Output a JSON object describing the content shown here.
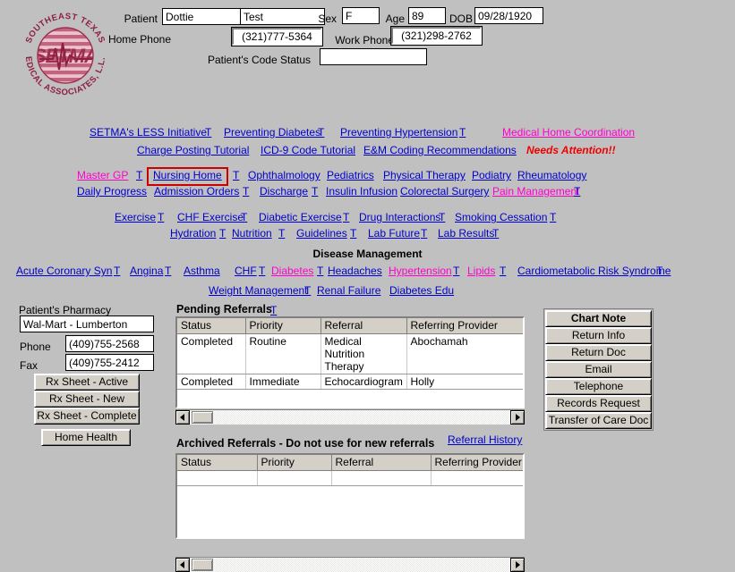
{
  "logo": {
    "top_arc": "SOUTHEAST TEXAS",
    "bottom_arc": "MEDICAL ASSOCIATES, L.L.P.",
    "center": "SETMA",
    "colors": {
      "dark": "#9e2f50",
      "mid": "#c4637f",
      "light": "#dba0b0"
    }
  },
  "patient": {
    "label_patient": "Patient",
    "first_name": "Dottie",
    "last_name": "Test",
    "label_sex": "Sex",
    "sex": "F",
    "label_age": "Age",
    "age": "89",
    "label_dob": "DOB",
    "dob": "09/28/1920",
    "label_home_phone": "Home Phone",
    "home_phone": "(321)777-5364",
    "label_work_phone": "Work Phone",
    "work_phone": "(321)298-2762",
    "label_code_status": "Patient's Code Status",
    "code_status": ""
  },
  "nav": {
    "t_label": "T",
    "row1": [
      {
        "label": "SETMA's LESS Initiative",
        "color": "blue",
        "t": true
      },
      {
        "label": "Preventing Diabetes",
        "color": "blue",
        "t": true
      },
      {
        "label": "Preventing Hypertension",
        "color": "blue",
        "t": true
      }
    ],
    "row1_right": {
      "label": "Medical Home Coordination",
      "color": "magenta",
      "alert": "Needs Attention!!"
    },
    "row2": [
      {
        "label": "Charge Posting Tutorial",
        "color": "blue",
        "t": false
      },
      {
        "label": "ICD-9 Code Tutorial",
        "color": "blue",
        "t": false
      },
      {
        "label": "E&M Coding Recommendations",
        "color": "blue",
        "t": false
      }
    ],
    "row3": [
      {
        "label": "Master GP",
        "color": "magenta",
        "t": true
      },
      {
        "label": "Nursing Home",
        "color": "blue",
        "t": true,
        "highlighted": true
      },
      {
        "label": "Ophthalmology",
        "color": "blue",
        "t": false
      },
      {
        "label": "Pediatrics",
        "color": "blue",
        "t": false
      },
      {
        "label": "Physical Therapy",
        "color": "blue",
        "t": false
      },
      {
        "label": "Podiatry",
        "color": "blue",
        "t": false
      },
      {
        "label": "Rheumatology",
        "color": "blue",
        "t": false
      }
    ],
    "row4": [
      {
        "label": "Daily Progress",
        "color": "blue",
        "t": false
      },
      {
        "label": "Admission Orders",
        "color": "blue",
        "t": true
      },
      {
        "label": "Discharge",
        "color": "blue",
        "t": true
      },
      {
        "label": "Insulin Infusion",
        "color": "blue",
        "t": false
      },
      {
        "label": "Colorectal Surgery",
        "color": "blue",
        "t": false
      },
      {
        "label": "Pain Management",
        "color": "magenta",
        "t": true
      }
    ],
    "row5": [
      {
        "label": "Exercise",
        "color": "blue",
        "t": true
      },
      {
        "label": "CHF Exercise",
        "color": "blue",
        "t": true
      },
      {
        "label": "Diabetic Exercise",
        "color": "blue",
        "t": true
      },
      {
        "label": "Drug Interactions",
        "color": "blue",
        "t": true
      },
      {
        "label": "Smoking Cessation",
        "color": "blue",
        "t": true
      }
    ],
    "row6": [
      {
        "label": "Hydration",
        "color": "blue",
        "t": true
      },
      {
        "label": "Nutrition",
        "color": "blue",
        "t": true
      },
      {
        "label": "Guidelines",
        "color": "blue",
        "t": true
      },
      {
        "label": "Lab Future",
        "color": "blue",
        "t": true
      },
      {
        "label": "Lab Results",
        "color": "blue",
        "t": true
      }
    ]
  },
  "disease_management": {
    "heading": "Disease Management",
    "row1": [
      {
        "label": "Acute Coronary Syn",
        "color": "blue",
        "t": true
      },
      {
        "label": "Angina",
        "color": "blue",
        "t": true
      },
      {
        "label": "Asthma",
        "color": "blue",
        "t": false
      },
      {
        "label": "CHF",
        "color": "blue",
        "t": true
      },
      {
        "label": "Diabetes",
        "color": "magenta",
        "t": true
      },
      {
        "label": "Headaches",
        "color": "blue",
        "t": false
      },
      {
        "label": "Hypertension",
        "color": "magenta",
        "t": true
      },
      {
        "label": "Lipids",
        "color": "magenta",
        "t": true
      },
      {
        "label": "Cardiometabolic Risk Syndrome",
        "color": "blue",
        "t": true
      }
    ],
    "row2": [
      {
        "label": "Weight Management",
        "color": "blue",
        "t": true
      },
      {
        "label": "Renal Failure",
        "color": "blue",
        "t": false
      },
      {
        "label": "Diabetes Edu",
        "color": "blue",
        "t": false
      }
    ]
  },
  "pharmacy": {
    "title": "Patient's Pharmacy",
    "name": "Wal-Mart - Lumberton",
    "label_phone": "Phone",
    "phone": "(409)755-2568",
    "label_fax": "Fax",
    "fax": "(409)755-2412",
    "buttons": [
      "Rx Sheet - Active",
      "Rx Sheet - New",
      "Rx Sheet - Complete"
    ],
    "home_health_button": "Home Health"
  },
  "pending_referrals": {
    "title": "Pending Referrals",
    "t_label": "T",
    "columns": [
      "Status",
      "Priority",
      "Referral",
      "Referring Provider"
    ],
    "rows": [
      {
        "status": "Completed",
        "priority": "Routine",
        "referral": "Medical Nutrition Therapy",
        "provider": "Abochamah"
      },
      {
        "status": "Completed",
        "priority": "Immediate",
        "referral": "Echocardiogram",
        "provider": "Holly"
      }
    ]
  },
  "archived_referrals": {
    "title": "Archived Referrals - Do not use for new referrals",
    "history_link": "Referral History",
    "columns": [
      "Status",
      "Priority",
      "Referral",
      "Referring Provider"
    ],
    "rows": []
  },
  "action_buttons": [
    {
      "label": "Chart Note",
      "bold": true
    },
    {
      "label": "Return Info",
      "bold": false
    },
    {
      "label": "Return Doc",
      "bold": false
    },
    {
      "label": "Email",
      "bold": false
    },
    {
      "label": "Telephone",
      "bold": false
    },
    {
      "label": "Records Request",
      "bold": false
    },
    {
      "label": "Transfer of Care Doc",
      "bold": false
    }
  ],
  "colors": {
    "background": "#c0c0c0",
    "link": "#0000cc",
    "link_alt": "#ff00cc",
    "alert": "#ee0000",
    "button_face": "#d4d0c8",
    "highlight_box": "#cc0000"
  }
}
